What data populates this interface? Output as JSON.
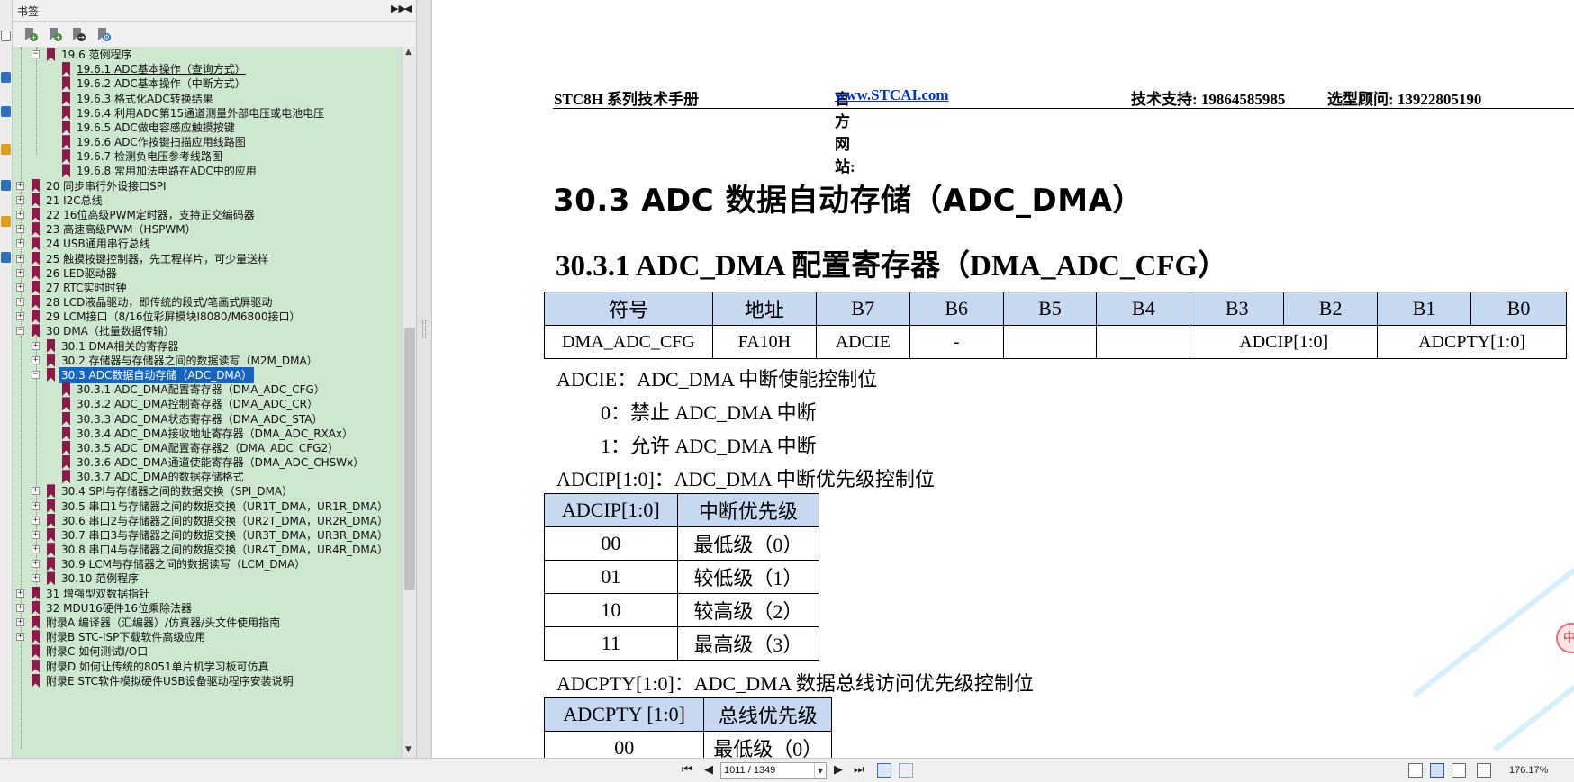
{
  "panel": {
    "title": "书签",
    "collapse_icon": "▶▶",
    "close_icon": "◀",
    "toolbar": [
      {
        "name": "expand-bookmarks-button",
        "badge": "+",
        "badge_color": "#4a8c3a"
      },
      {
        "name": "add-bookmark-button",
        "badge": "+",
        "badge_color": "#4a8c3a"
      },
      {
        "name": "goto-bookmark-button",
        "badge": "→",
        "badge_color": "#333333"
      },
      {
        "name": "bookmark-settings-button",
        "badge": "⚙",
        "badge_color": "#2a6ac0"
      }
    ]
  },
  "tree": [
    {
      "text": "19.6 范例程序",
      "level": 2,
      "exp": "−"
    },
    {
      "text": "19.6.1 ADC基本操作（查询方式）",
      "level": 3,
      "exp": "",
      "current": true
    },
    {
      "text": "19.6.2 ADC基本操作（中断方式）",
      "level": 3,
      "exp": ""
    },
    {
      "text": "19.6.3 格式化ADC转换结果",
      "level": 3,
      "exp": ""
    },
    {
      "text": "19.6.4 利用ADC第15通道测量外部电压或电池电压",
      "level": 3,
      "exp": ""
    },
    {
      "text": "19.6.5 ADC做电容感应触摸按键",
      "level": 3,
      "exp": ""
    },
    {
      "text": "19.6.6 ADC作按键扫描应用线路图",
      "level": 3,
      "exp": ""
    },
    {
      "text": "19.6.7 检测负电压参考线路图",
      "level": 3,
      "exp": ""
    },
    {
      "text": "19.6.8 常用加法电路在ADC中的应用",
      "level": 3,
      "exp": ""
    },
    {
      "text": "20 同步串行外设接口SPI",
      "level": 1,
      "exp": "+"
    },
    {
      "text": "21 I2C总线",
      "level": 1,
      "exp": "+"
    },
    {
      "text": "22 16位高级PWM定时器，支持正交编码器",
      "level": 1,
      "exp": "+"
    },
    {
      "text": "23 高速高级PWM（HSPWM）",
      "level": 1,
      "exp": "+"
    },
    {
      "text": "24 USB通用串行总线",
      "level": 1,
      "exp": "+"
    },
    {
      "text": "25 触摸按键控制器，先工程样片，可少量送样",
      "level": 1,
      "exp": "+"
    },
    {
      "text": "26 LED驱动器",
      "level": 1,
      "exp": "+"
    },
    {
      "text": "27 RTC实时时钟",
      "level": 1,
      "exp": "+"
    },
    {
      "text": "28 LCD液晶驱动，即传统的段式/笔画式屏驱动",
      "level": 1,
      "exp": "+"
    },
    {
      "text": "29 LCM接口（8/16位彩屏模块I8080/M6800接口）",
      "level": 1,
      "exp": "+"
    },
    {
      "text": "30 DMA（批量数据传输）",
      "level": 1,
      "exp": "−"
    },
    {
      "text": "30.1 DMA相关的寄存器",
      "level": 2,
      "exp": "+"
    },
    {
      "text": "30.2 存储器与存储器之间的数据读写（M2M_DMA）",
      "level": 2,
      "exp": "+"
    },
    {
      "text": "30.3 ADC数据自动存储（ADC_DMA）",
      "level": 2,
      "exp": "−",
      "selected": true
    },
    {
      "text": "30.3.1 ADC_DMA配置寄存器（DMA_ADC_CFG）",
      "level": 3,
      "exp": ""
    },
    {
      "text": "30.3.2 ADC_DMA控制寄存器（DMA_ADC_CR）",
      "level": 3,
      "exp": ""
    },
    {
      "text": "30.3.3 ADC_DMA状态寄存器（DMA_ADC_STA）",
      "level": 3,
      "exp": ""
    },
    {
      "text": "30.3.4 ADC_DMA接收地址寄存器（DMA_ADC_RXAx）",
      "level": 3,
      "exp": ""
    },
    {
      "text": "30.3.5 ADC_DMA配置寄存器2（DMA_ADC_CFG2）",
      "level": 3,
      "exp": ""
    },
    {
      "text": "30.3.6 ADC_DMA通道使能寄存器（DMA_ADC_CHSWx）",
      "level": 3,
      "exp": ""
    },
    {
      "text": "30.3.7 ADC_DMA的数据存储格式",
      "level": 3,
      "exp": ""
    },
    {
      "text": "30.4 SPI与存储器之间的数据交换（SPI_DMA）",
      "level": 2,
      "exp": "+"
    },
    {
      "text": "30.5 串口1与存储器之间的数据交换（UR1T_DMA，UR1R_DMA）",
      "level": 2,
      "exp": "+"
    },
    {
      "text": "30.6 串口2与存储器之间的数据交换（UR2T_DMA，UR2R_DMA）",
      "level": 2,
      "exp": "+"
    },
    {
      "text": "30.7 串口3与存储器之间的数据交换（UR3T_DMA，UR3R_DMA）",
      "level": 2,
      "exp": "+"
    },
    {
      "text": "30.8 串口4与存储器之间的数据交换（UR4T_DMA，UR4R_DMA）",
      "level": 2,
      "exp": "+"
    },
    {
      "text": "30.9 LCM与存储器之间的数据读写（LCM_DMA）",
      "level": 2,
      "exp": "+"
    },
    {
      "text": "30.10 范例程序",
      "level": 2,
      "exp": "+"
    },
    {
      "text": "31 增强型双数据指针",
      "level": 1,
      "exp": "+"
    },
    {
      "text": "32 MDU16硬件16位乘除法器",
      "level": 1,
      "exp": "+"
    },
    {
      "text": "附录A 编译器（汇编器）/仿真器/头文件使用指南",
      "level": 1,
      "exp": "+"
    },
    {
      "text": "附录B STC-ISP下载软件高级应用",
      "level": 1,
      "exp": "+"
    },
    {
      "text": "附录C 如何测试I/O口",
      "level": 1,
      "exp": ""
    },
    {
      "text": "附录D 如何让传统的8051单片机学习板可仿真",
      "level": 1,
      "exp": ""
    },
    {
      "text": "附录E STC软件模拟硬件USB设备驱动程序安装说明",
      "level": 1,
      "exp": ""
    }
  ],
  "doc": {
    "header": {
      "series": "STC8H 系列技术手册",
      "site_label": "官方网站: ",
      "site_link": "www.STCAI.com",
      "support": "技术支持: 19864585985",
      "advisor": "选型顾问: 13922805190"
    },
    "h1": "30.3   ADC 数据自动存储（ADC_DMA）",
    "h2": "30.3.1    ADC_DMA 配置寄存器（DMA_ADC_CFG）",
    "reg_table": {
      "header": [
        "符号",
        "地址",
        "B7",
        "B6",
        "B5",
        "B4",
        "B3",
        "B2",
        "B1",
        "B0"
      ],
      "row": [
        "DMA_ADC_CFG",
        "FA10H",
        "ADCIE",
        "-",
        "",
        "",
        "ADCIP[1:0]",
        "ADCPTY[1:0]"
      ]
    },
    "adcie_title": "ADCIE：ADC_DMA 中断使能控制位",
    "adcie_0": "0：禁止 ADC_DMA 中断",
    "adcie_1": "1：允许 ADC_DMA 中断",
    "adcip_title": "ADCIP[1:0]：ADC_DMA 中断优先级控制位",
    "adcip_table": {
      "header": [
        "ADCIP[1:0]",
        "中断优先级"
      ],
      "rows": [
        [
          "00",
          "最低级（0）"
        ],
        [
          "01",
          "较低级（1）"
        ],
        [
          "10",
          "较高级（2）"
        ],
        [
          "11",
          "最高级（3）"
        ]
      ]
    },
    "adcpty_title": "ADCPTY[1:0]：ADC_DMA 数据总线访问优先级控制位",
    "adcpty_table": {
      "header": [
        "ADCPTY [1:0]",
        "总线优先级"
      ],
      "rows": [
        [
          "00",
          "最低级（0）"
        ]
      ]
    },
    "float_icon": "中"
  },
  "status": {
    "first_page": "⏮",
    "prev_page": "◀",
    "page_value": "1011 / 1349",
    "page_drop": "▼",
    "next_page": "▶",
    "last_page": "⏭",
    "zoom": "176.17%"
  },
  "colors": {
    "tree_bg": "#cde8cf",
    "selected": "#1565c0",
    "table_header": "#c6d9f1",
    "bookmark": "#8b1a4a",
    "link": "#0033cc"
  }
}
